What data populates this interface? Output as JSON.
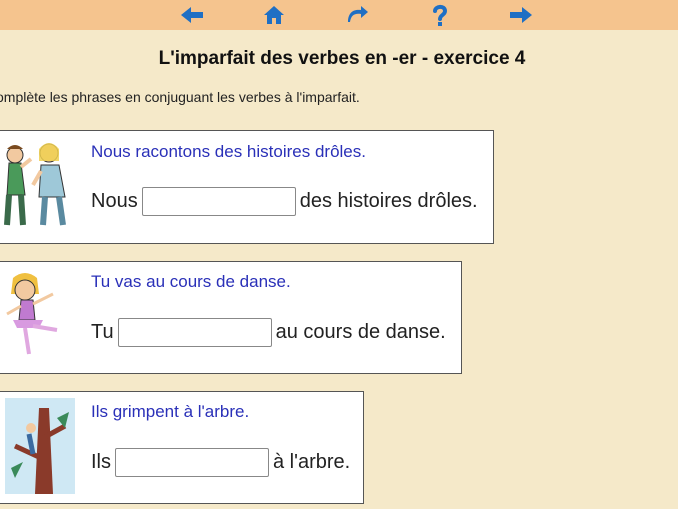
{
  "nav": {
    "items": [
      {
        "name": "back-arrow-icon"
      },
      {
        "name": "home-icon"
      },
      {
        "name": "redo-icon"
      },
      {
        "name": "help-icon"
      },
      {
        "name": "forward-arrow-icon"
      }
    ],
    "icon_color": "#1f6fc4",
    "bar_color": "#f5c48e"
  },
  "page": {
    "title": "L'imparfait des verbes en -er - exercice 4",
    "instruction": "omplète les phrases en conjuguant les verbes à l'imparfait."
  },
  "exercises": [
    {
      "sentence": "Nous racontons des histoires drôles.",
      "prefix": "Nous",
      "suffix": "des histoires drôles.",
      "answer_value": ""
    },
    {
      "sentence": "Tu vas au cours de danse.",
      "prefix": "Tu",
      "suffix": "au cours de danse.",
      "answer_value": ""
    },
    {
      "sentence": "Ils grimpent à l'arbre.",
      "prefix": "Ils",
      "suffix": "à l'arbre.",
      "answer_value": ""
    }
  ]
}
